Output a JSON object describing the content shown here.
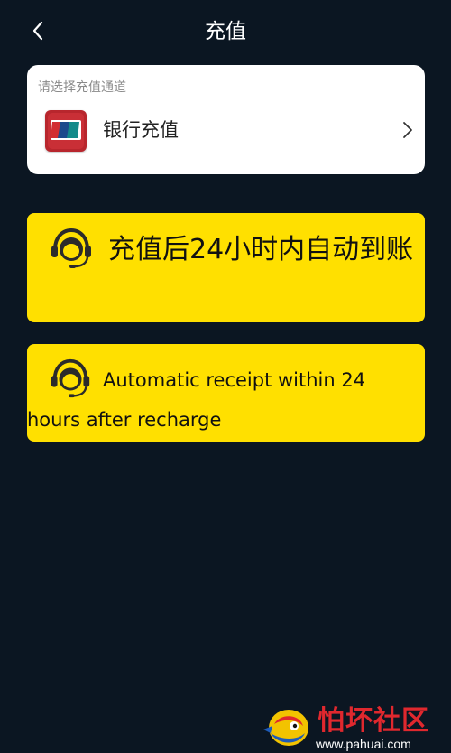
{
  "header": {
    "title": "充值",
    "back_icon": "chevron-left-icon"
  },
  "channel_card": {
    "hint": "请选择充值通道",
    "channel": {
      "label": "银行充值",
      "icon": "unionpay-icon",
      "arrow_icon": "chevron-right-icon"
    }
  },
  "notices": [
    {
      "icon": "headset-support-icon",
      "text": "充值后24小时内自动到账"
    },
    {
      "icon": "headset-support-icon",
      "text": "Automatic receipt within 24 hours after recharge"
    }
  ],
  "watermark": {
    "name": "怕坏社区",
    "url": "www.pahuai.com"
  },
  "colors": {
    "background": "#0b1622",
    "card": "#ffffff",
    "notice": "#ffe000",
    "watermark_red": "#e0282e"
  }
}
